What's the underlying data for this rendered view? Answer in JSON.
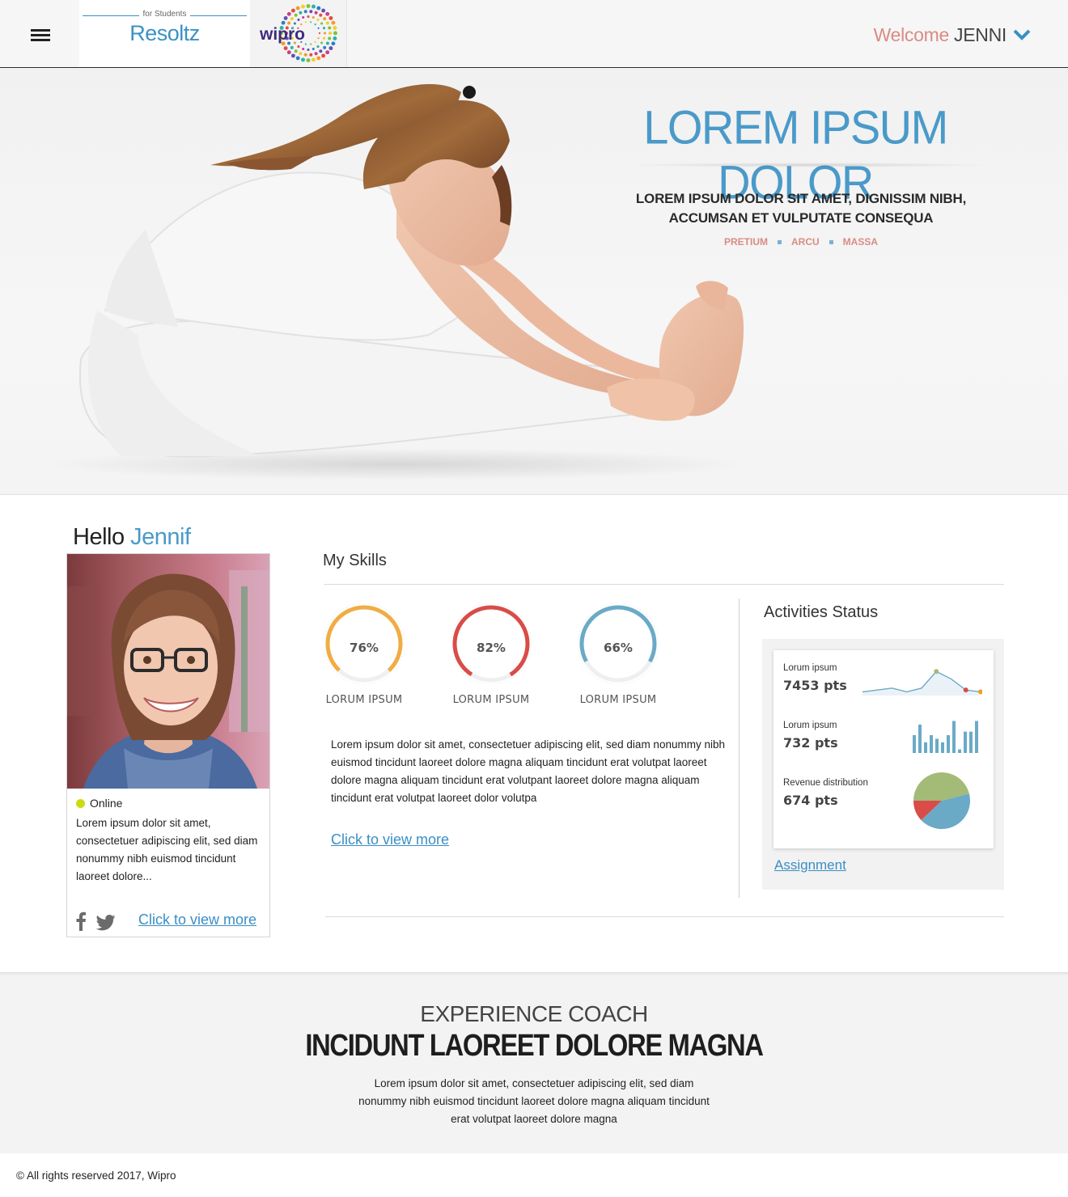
{
  "header": {
    "brand_tag": "for Students",
    "brand_name": "Resoltz",
    "partner_logo_text": "wipro",
    "welcome_label": "Welcome",
    "user_name": "JENNI",
    "menu_icon": "hamburger-menu-icon",
    "dropdown_icon": "chevron-down-icon"
  },
  "hero": {
    "title": "LOREM IPSUM DOLOR",
    "subtitle_line1": "LOREM IPSUM DOLOR SIT AMET, DIGNISSIM NIBH,",
    "subtitle_line2": "ACCUMSAN ET VULPUTATE CONSEQUA",
    "tags": [
      "PRETIUM",
      "ARCU",
      "MASSA"
    ]
  },
  "profile": {
    "greeting": "Hello",
    "name": "Jennif",
    "status": "Online",
    "status_color": "#c8dc10",
    "bio": "Lorem ipsum dolor sit amet, consectetuer adipiscing elit, sed diam nonummy nibh euismod tincidunt laoreet dolore...",
    "social_icons": [
      "facebook-icon",
      "twitter-icon"
    ],
    "more_link": "Click to view more"
  },
  "skills": {
    "title": "My Skills",
    "items": [
      {
        "percent": 76,
        "label_text": "76%",
        "caption": "LORUM IPSUM",
        "color": "#f0ad44"
      },
      {
        "percent": 82,
        "label_text": "82%",
        "caption": "LORUM IPSUM",
        "color": "#d94c47"
      },
      {
        "percent": 66,
        "label_text": "66%",
        "caption": "LORUM IPSUM",
        "color": "#6aaac7"
      }
    ],
    "description": "Lorem ipsum dolor sit amet, consectetuer adipiscing elit, sed diam nonummy nibh euismod tincidunt laoreet dolore magna aliquam tincidunt erat volutpat laoreet dolore magna aliquam tincidunt erat volutpant laoreet dolore magna aliquam tincidunt erat volutpat laoreet dolor volutpa",
    "more_link": "Click to view more"
  },
  "activities": {
    "title": "Activities Status",
    "rows": [
      {
        "caption": "Lorum ipsum",
        "value": "7453 pts",
        "chart": "sparkline"
      },
      {
        "caption": "Lorum ipsum",
        "value": "732 pts",
        "chart": "bars"
      },
      {
        "caption": "Revenue distribution",
        "value": "674 pts",
        "chart": "pie"
      }
    ],
    "sparkline_values": [
      2,
      3,
      4,
      2,
      4,
      13,
      9,
      3,
      2
    ],
    "bar_values": [
      5,
      8,
      3,
      5,
      4,
      3,
      5,
      9,
      1,
      6,
      6,
      9
    ],
    "pie_slices": [
      {
        "value": 46,
        "color": "#a4bb78"
      },
      {
        "value": 42,
        "color": "#6aaac7"
      },
      {
        "value": 12,
        "color": "#d94c47"
      }
    ],
    "link": "Assignment"
  },
  "coach": {
    "kicker": "EXPERIENCE COACH",
    "title": "INCIDUNT LAOREET DOLORE MAGNA",
    "text": "Lorem ipsum dolor sit amet, consectetuer adipiscing elit, sed diam nonummy nibh euismod tincidunt laoreet dolore magna aliquam tincidunt erat volutpat laoreet dolore magna"
  },
  "footer": {
    "copyright": "© All rights reserved 2017, Wipro"
  },
  "colors": {
    "accent_blue": "#3a8fc4",
    "title_blue": "#4a9ac9",
    "salmon": "#d98c83"
  }
}
